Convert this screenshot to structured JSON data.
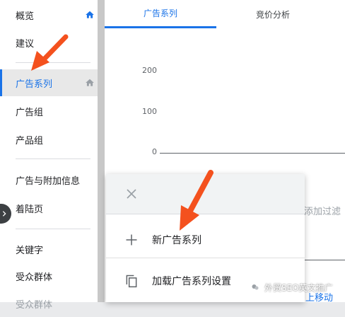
{
  "sidebar": {
    "items": [
      {
        "label": "概览"
      },
      {
        "label": "建议"
      },
      {
        "label": "广告系列"
      },
      {
        "label": "广告组"
      },
      {
        "label": "产品组"
      },
      {
        "label": "广告与附加信息"
      },
      {
        "label": "着陆页"
      },
      {
        "label": "关键字"
      },
      {
        "label": "受众群体"
      },
      {
        "label": "受众群体"
      }
    ],
    "active_index": 2
  },
  "tabs": [
    {
      "label": "广告系列"
    },
    {
      "label": "竞价分析"
    }
  ],
  "chart": {
    "ticks": [
      "200",
      "100",
      "0"
    ]
  },
  "main": {
    "filter_placeholder": "添加过滤",
    "bottom_link": "上移动"
  },
  "popup": {
    "items": [
      {
        "label": "新广告系列",
        "icon": "plus-icon"
      },
      {
        "label": "加载广告系列设置",
        "icon": "copy-icon"
      }
    ]
  },
  "watermark": {
    "text": "外贸SEO英文推广"
  },
  "colors": {
    "accent": "#1a73e8",
    "arrow": "#f4511e"
  }
}
